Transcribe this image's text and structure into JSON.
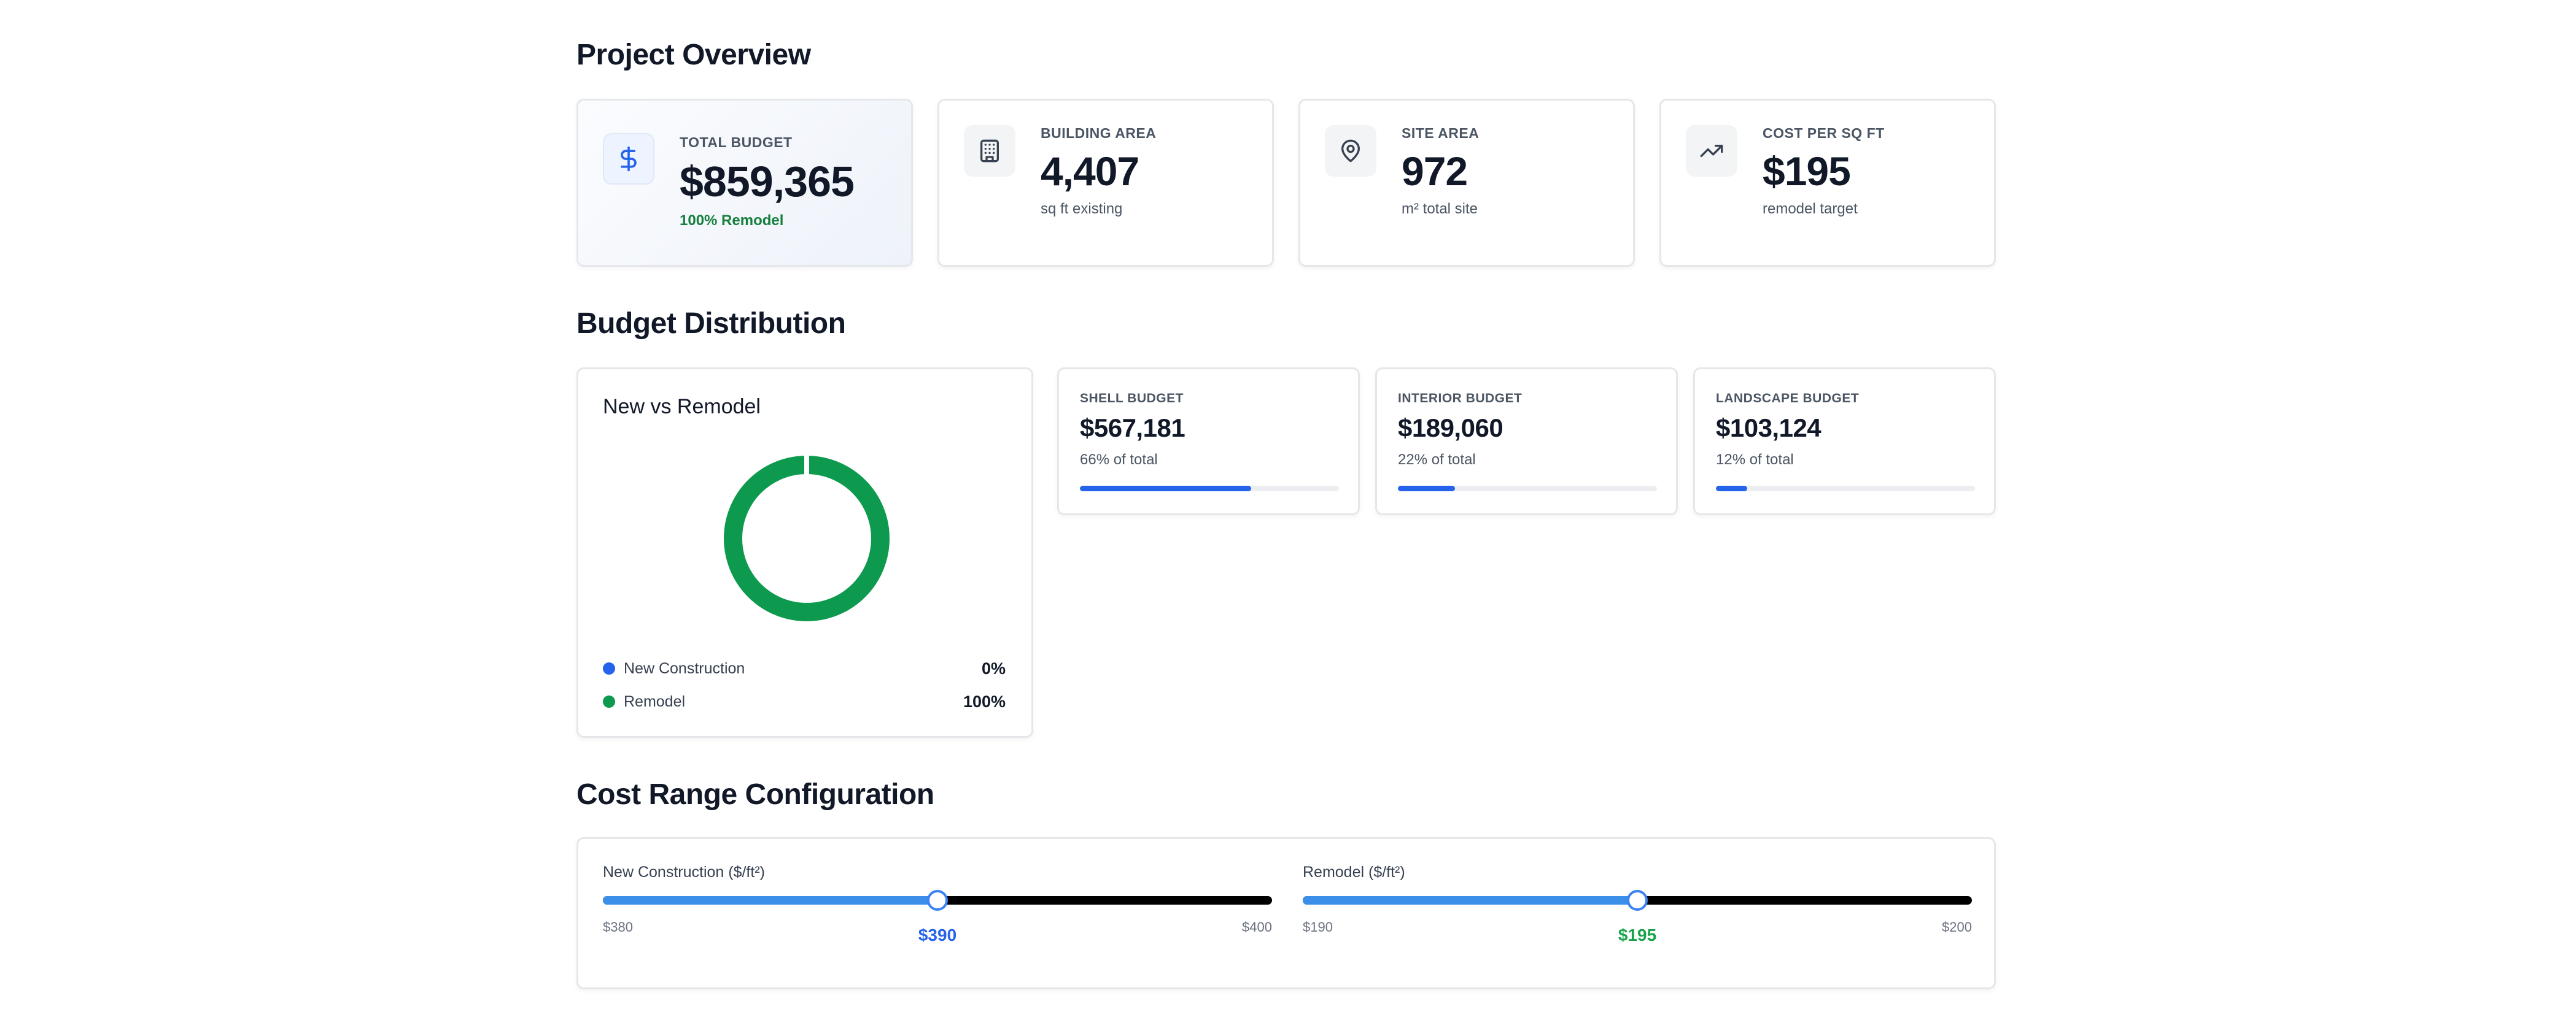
{
  "project_overview": {
    "title": "Project Overview",
    "cards": [
      {
        "label": "TOTAL BUDGET",
        "value": "$859,365",
        "sub": "100% Remodel",
        "icon": "dollar-icon"
      },
      {
        "label": "BUILDING AREA",
        "value": "4,407",
        "sub": "sq ft existing",
        "icon": "building-icon"
      },
      {
        "label": "SITE AREA",
        "value": "972",
        "sub": "m² total site",
        "icon": "map-pin-icon"
      },
      {
        "label": "COST PER SQ FT",
        "value": "$195",
        "sub": "remodel target",
        "icon": "trending-up-icon"
      }
    ]
  },
  "budget_distribution": {
    "title": "Budget Distribution",
    "donut": {
      "title": "New vs Remodel",
      "legend": [
        {
          "label": "New Construction",
          "value": "0%",
          "fraction": 0,
          "color": "#2563eb"
        },
        {
          "label": "Remodel",
          "value": "100%",
          "fraction": 1,
          "color": "#0e9a4e"
        }
      ]
    },
    "breakdown": [
      {
        "label": "SHELL BUDGET",
        "value": "$567,181",
        "sub": "66% of total",
        "fraction": 0.66
      },
      {
        "label": "INTERIOR BUDGET",
        "value": "$189,060",
        "sub": "22% of total",
        "fraction": 0.22
      },
      {
        "label": "LANDSCAPE BUDGET",
        "value": "$103,124",
        "sub": "12% of total",
        "fraction": 0.12
      }
    ]
  },
  "cost_range": {
    "title": "Cost Range Configuration",
    "sliders": [
      {
        "label": "New Construction ($/ft²)",
        "min_label": "$380",
        "max_label": "$400",
        "current_label": "$390",
        "min": 380,
        "max": 400,
        "value": 390,
        "value_color": "#2563eb"
      },
      {
        "label": "Remodel ($/ft²)",
        "min_label": "$190",
        "max_label": "$200",
        "current_label": "$195",
        "min": 190,
        "max": 200,
        "value": 195,
        "value_color": "#16a34a"
      }
    ]
  }
}
